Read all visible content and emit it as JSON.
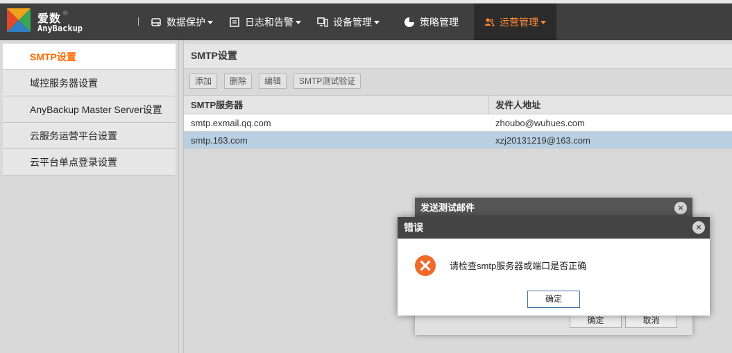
{
  "brand": {
    "name_cn": "爱数",
    "name_en": "AnyBackup",
    "mark": "®"
  },
  "nav": [
    {
      "label": "数据保护",
      "icon": "database-icon",
      "has_caret": true
    },
    {
      "label": "日志和告警",
      "icon": "log-icon",
      "has_caret": true
    },
    {
      "label": "设备管理",
      "icon": "device-icon",
      "has_caret": true
    },
    {
      "label": "策略管理",
      "icon": "pie-chart-icon",
      "has_caret": false
    },
    {
      "label": "运营管理",
      "icon": "users-icon",
      "has_caret": true,
      "active": true
    }
  ],
  "sidebar": {
    "items": [
      {
        "label": "SMTP设置",
        "active": true
      },
      {
        "label": "域控服务器设置"
      },
      {
        "label": "AnyBackup Master Server设置"
      },
      {
        "label": "云服务运营平台设置"
      },
      {
        "label": "云平台单点登录设置"
      }
    ]
  },
  "main": {
    "title": "SMTP设置",
    "toolbar": {
      "add": "添加",
      "delete": "删除",
      "edit": "编辑",
      "test": "SMTP测试验证"
    },
    "table": {
      "columns": [
        "SMTP服务器",
        "发件人地址"
      ],
      "rows": [
        {
          "server": "smtp.exmail.qq.com",
          "sender": "zhoubo@wuhues.com",
          "selected": false
        },
        {
          "server": "smtp.163.com",
          "sender": "xzj20131219@163.com",
          "selected": true
        }
      ]
    }
  },
  "test_dialog": {
    "title": "发送测试邮件",
    "ok": "确定",
    "cancel": "取消"
  },
  "error_dialog": {
    "title": "错误",
    "message": "请检查smtp服务器或端口是否正确",
    "ok": "确定"
  },
  "colors": {
    "accent": "#ff6a00",
    "nav_bg": "#3f3f3f",
    "error": "#f06a2a",
    "selected_row": "#b9cfe2"
  }
}
